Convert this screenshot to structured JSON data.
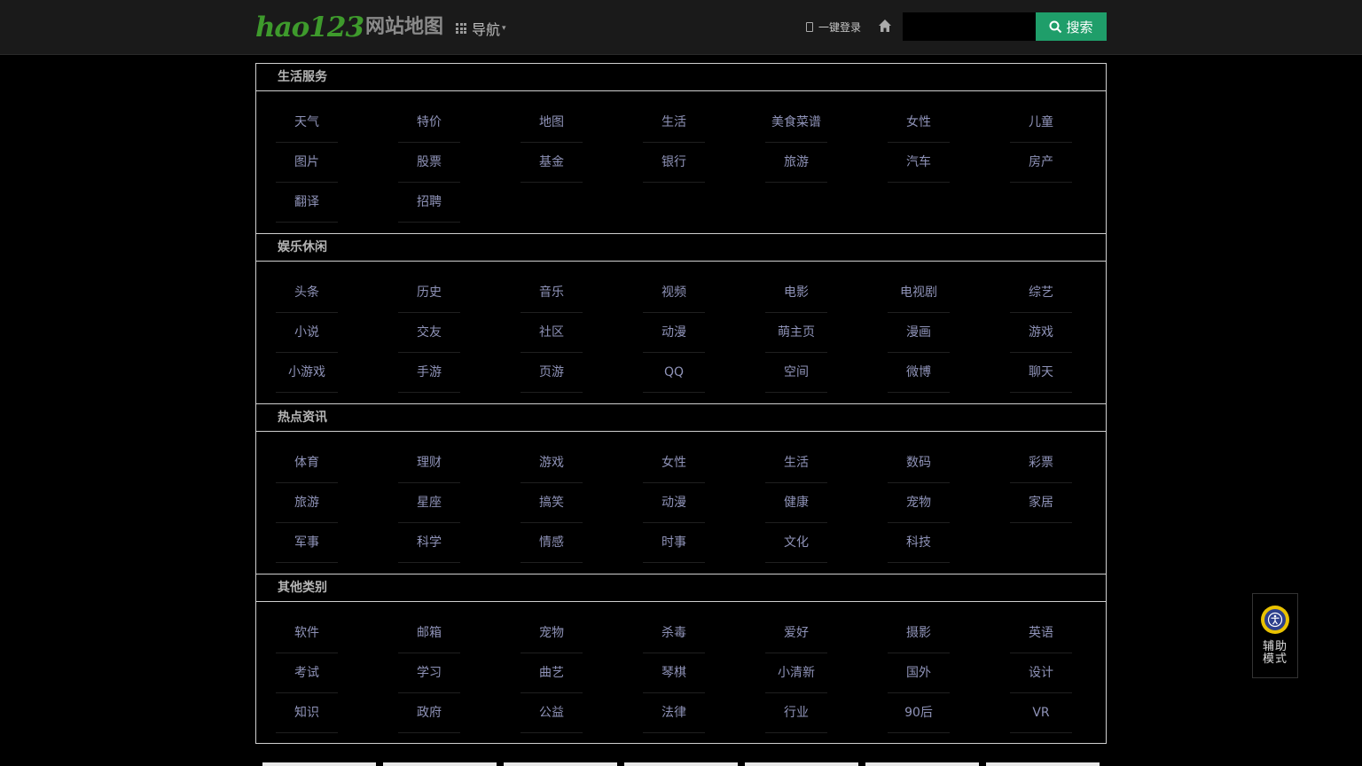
{
  "header": {
    "logo_brand": "hao123",
    "logo_suffix": "网站地图",
    "nav_label": "导航",
    "login_label": "一键登录",
    "search_placeholder": "",
    "search_button": "搜索"
  },
  "sections": [
    {
      "title": "生活服务",
      "links": [
        "天气",
        "特价",
        "地图",
        "生活",
        "美食菜谱",
        "女性",
        "儿童",
        "图片",
        "股票",
        "基金",
        "银行",
        "旅游",
        "汽车",
        "房产",
        "翻译",
        "招聘"
      ]
    },
    {
      "title": "娱乐休闲",
      "links": [
        "头条",
        "历史",
        "音乐",
        "视频",
        "电影",
        "电视剧",
        "综艺",
        "小说",
        "交友",
        "社区",
        "动漫",
        "萌主页",
        "漫画",
        "游戏",
        "小游戏",
        "手游",
        "页游",
        "QQ",
        "空间",
        "微博",
        "聊天"
      ]
    },
    {
      "title": "热点资讯",
      "links": [
        "体育",
        "理财",
        "游戏",
        "女性",
        "生活",
        "数码",
        "彩票",
        "旅游",
        "星座",
        "搞笑",
        "动漫",
        "健康",
        "宠物",
        "家居",
        "军事",
        "科学",
        "情感",
        "时事",
        "文化",
        "科技"
      ]
    },
    {
      "title": "其他类别",
      "links": [
        "软件",
        "邮箱",
        "宠物",
        "杀毒",
        "爱好",
        "摄影",
        "英语",
        "考试",
        "学习",
        "曲艺",
        "琴棋",
        "小清新",
        "国外",
        "设计",
        "知识",
        "政府",
        "公益",
        "法律",
        "行业",
        "90后",
        "VR"
      ]
    }
  ],
  "assist": {
    "label": "辅助模式"
  },
  "colors": {
    "accent": "#1f9e6a",
    "brand": "#3e9a2c",
    "link": "#8f93b8"
  }
}
